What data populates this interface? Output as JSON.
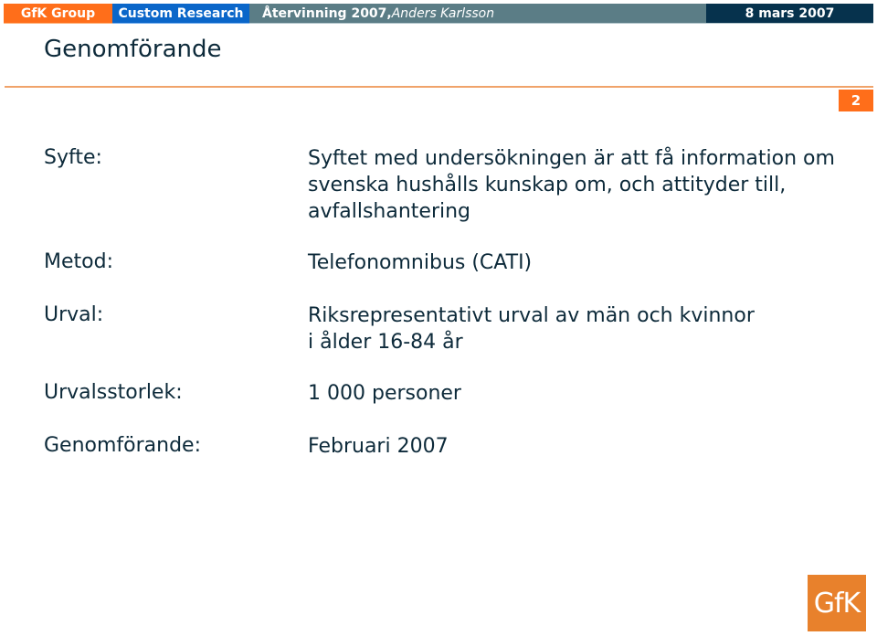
{
  "header": {
    "group_label": "GfK Group",
    "division_label": "Custom Research",
    "presentation_title": "Återvinning 2007,",
    "author": " Anders Karlsson",
    "date": "8 mars 2007"
  },
  "page": {
    "title": "Genomförande",
    "number": "2"
  },
  "rows": [
    {
      "label": "Syfte:",
      "value": "Syftet med undersökningen är att få information om\nsvenska hushålls kunskap om, och attityder till,\navfallshantering"
    },
    {
      "label": "Metod:",
      "value": "Telefonomnibus (CATI)"
    },
    {
      "label": "Urval:",
      "value": "Riksrepresentativt urval av män och kvinnor\ni ålder 16-84 år"
    },
    {
      "label": "Urvalsstorlek:",
      "value": "1 000 personer"
    },
    {
      "label": "Genomförande:",
      "value": "Februari 2007"
    }
  ],
  "logo": {
    "text": "GfK"
  },
  "colors": {
    "orange": "#ff6e1a",
    "blue": "#0a66c9",
    "slate": "#5b7d86",
    "navy": "#06324d",
    "logo_orange": "#e8812c"
  }
}
